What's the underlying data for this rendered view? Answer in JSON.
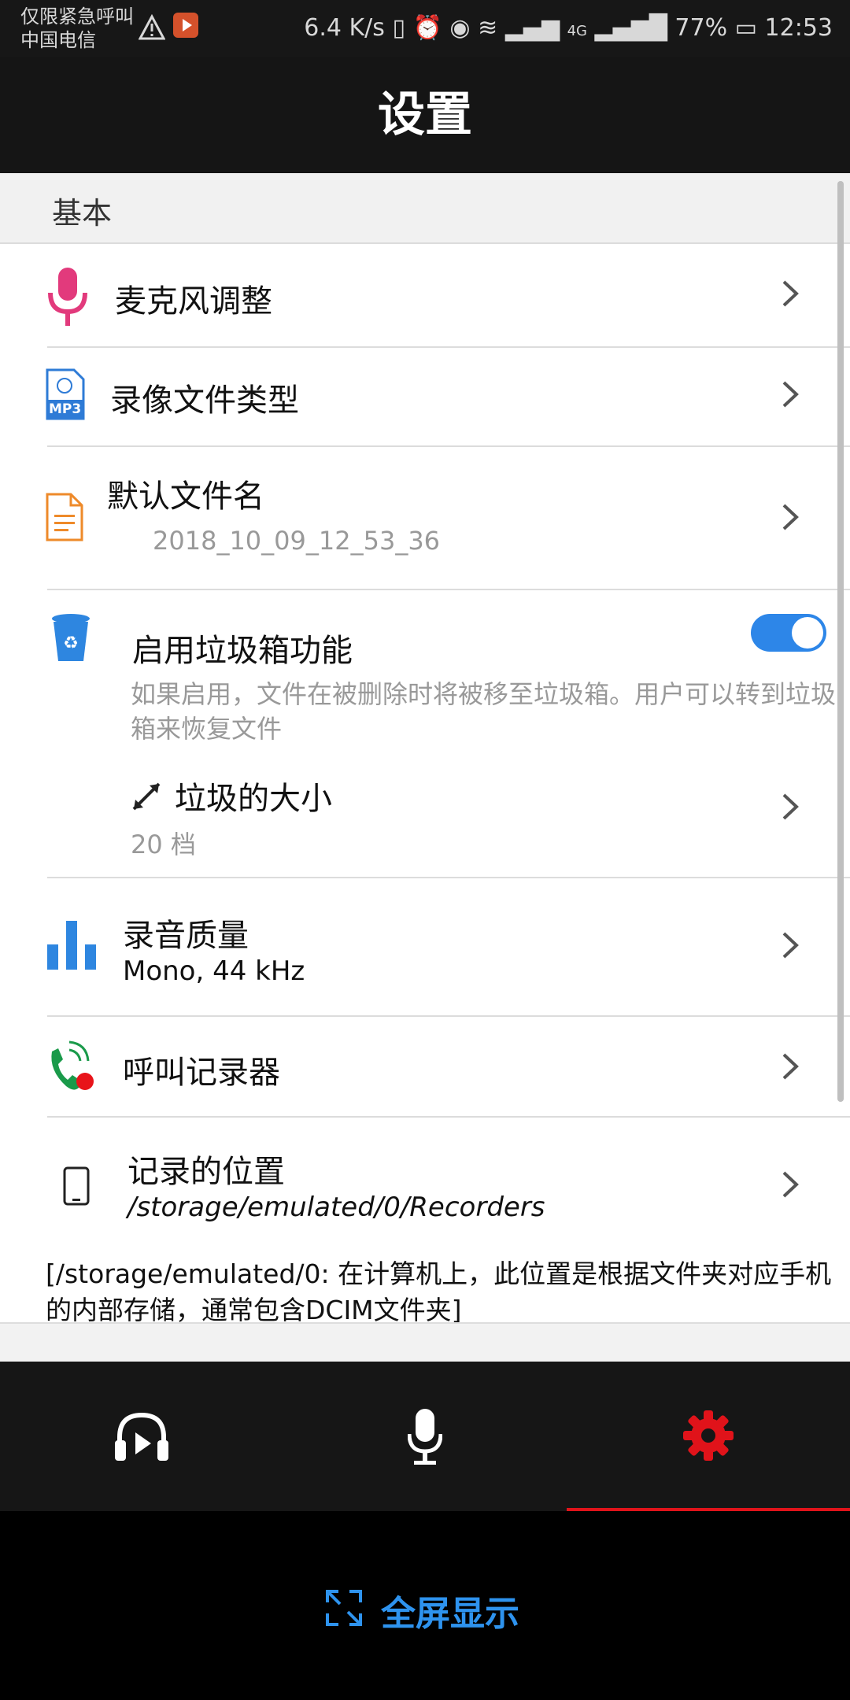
{
  "status_bar": {
    "carrier_line1": "仅限紧急呼叫",
    "carrier_line2": "中国电信",
    "network_speed": "6.4 K/s",
    "network_type": "4G",
    "battery": "77%",
    "time": "12:53"
  },
  "header": {
    "title": "设置"
  },
  "section": {
    "label": "基本"
  },
  "items": {
    "mic": {
      "title": "麦克风调整"
    },
    "video_type": {
      "title": "录像文件类型",
      "icon_badge": "MP3"
    },
    "default_name": {
      "title": "默认文件名",
      "value": "2018_10_09_12_53_36"
    },
    "trash": {
      "title": "启用垃圾箱功能",
      "description": "如果启用，文件在被删除时将被移至垃圾箱。用户可以转到垃圾箱来恢复文件",
      "enabled": true
    },
    "trash_size": {
      "title": "垃圾的大小",
      "value": "20 档"
    },
    "quality": {
      "title": "录音质量",
      "value": "Mono, 44 kHz"
    },
    "call_recorder": {
      "title": "呼叫记录器"
    },
    "location": {
      "title": "记录的位置",
      "value": "/storage/emulated/0/Recorders"
    }
  },
  "storage_note": "[/storage/emulated/0: 在计算机上，此位置是根据文件夹对应手机的内部存储，通常包含DCIM文件夹]",
  "bottom_nav": {
    "items": [
      "player-icon",
      "microphone-icon",
      "gear-icon"
    ],
    "active": "gear-icon",
    "active_color": "#e0131a"
  },
  "fullscreen_bar": {
    "label": "全屏显示"
  }
}
